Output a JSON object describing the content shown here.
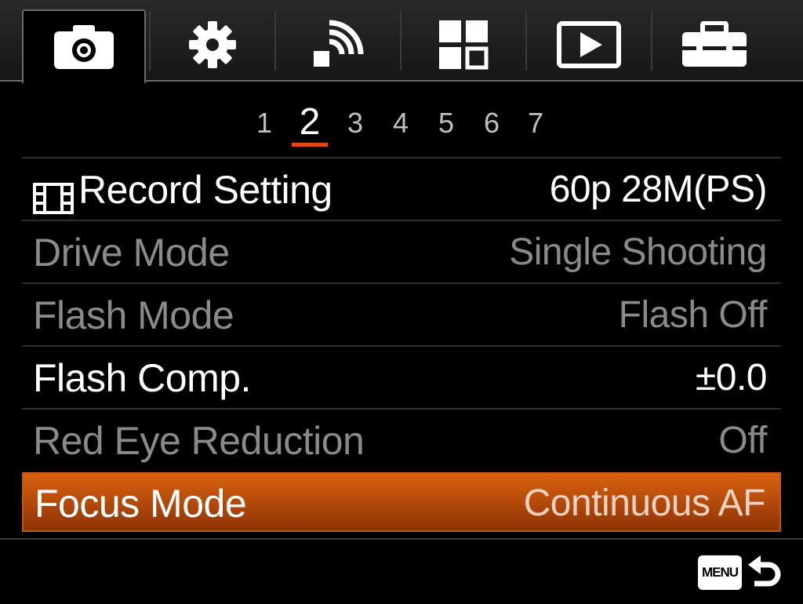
{
  "tabs": [
    {
      "name": "camera-icon",
      "active": true
    },
    {
      "name": "gear-icon",
      "active": false
    },
    {
      "name": "wireless-icon",
      "active": false
    },
    {
      "name": "application-grid-icon",
      "active": false
    },
    {
      "name": "playback-icon",
      "active": false
    },
    {
      "name": "toolbox-icon",
      "active": false
    }
  ],
  "pages": [
    "1",
    "2",
    "3",
    "4",
    "5",
    "6",
    "7"
  ],
  "current_page": "2",
  "rows": [
    {
      "label": "Record Setting",
      "value": "60p 28M(PS)",
      "state": "enabled",
      "icon": "movie-film-icon"
    },
    {
      "label": "Drive Mode",
      "value": "Single Shooting",
      "state": "disabled"
    },
    {
      "label": "Flash Mode",
      "value": "Flash Off",
      "state": "disabled"
    },
    {
      "label": "Flash Comp.",
      "value": "±0.0",
      "state": "enabled"
    },
    {
      "label": "Red Eye Reduction",
      "value": "Off",
      "state": "disabled"
    },
    {
      "label": "Focus Mode",
      "value": "Continuous AF",
      "state": "selected"
    }
  ],
  "footer": {
    "menu_label": "MENU",
    "back_icon": "return-arrow-icon"
  },
  "colors": {
    "accent": "#e8461a",
    "selected_row_top": "#d9620f",
    "selected_row_bottom": "#8e3306",
    "disabled_text": "#8a8a8a"
  }
}
